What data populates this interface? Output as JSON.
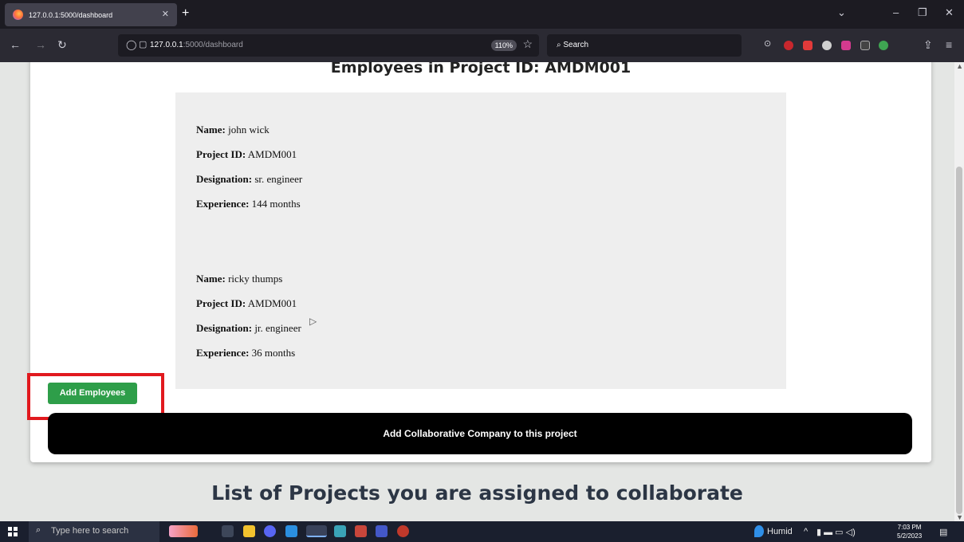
{
  "browser": {
    "tab_title": "127.0.0.1:5000/dashboard",
    "url_host": "127.0.0.1",
    "url_path": ":5000/dashboard",
    "zoom": "110%",
    "search_placeholder": "Search"
  },
  "page": {
    "heading": "Employees in Project ID: AMDM001",
    "employees": [
      {
        "name_label": "Name:",
        "name": "john wick",
        "project_label": "Project ID:",
        "project_id": "AMDM001",
        "designation_label": "Designation:",
        "designation": "sr. engineer",
        "experience_label": "Experience:",
        "experience": "144 months"
      },
      {
        "name_label": "Name:",
        "name": "ricky thumps",
        "project_label": "Project ID:",
        "project_id": "AMDM001",
        "designation_label": "Designation:",
        "designation": "jr. engineer",
        "experience_label": "Experience:",
        "experience": "36 months"
      }
    ],
    "add_employees_label": "Add Employees",
    "add_collab_label": "Add Collaborative Company to this project",
    "list_title": "List of Projects you are assigned to collaborate",
    "colors": {
      "add_button": "#2e9e49",
      "highlight": "#e1191e",
      "collab_button": "#000000"
    }
  },
  "taskbar": {
    "search_placeholder": "Type here to search",
    "weather": "Humid",
    "time": "7:03 PM",
    "date": "5/2/2023"
  }
}
